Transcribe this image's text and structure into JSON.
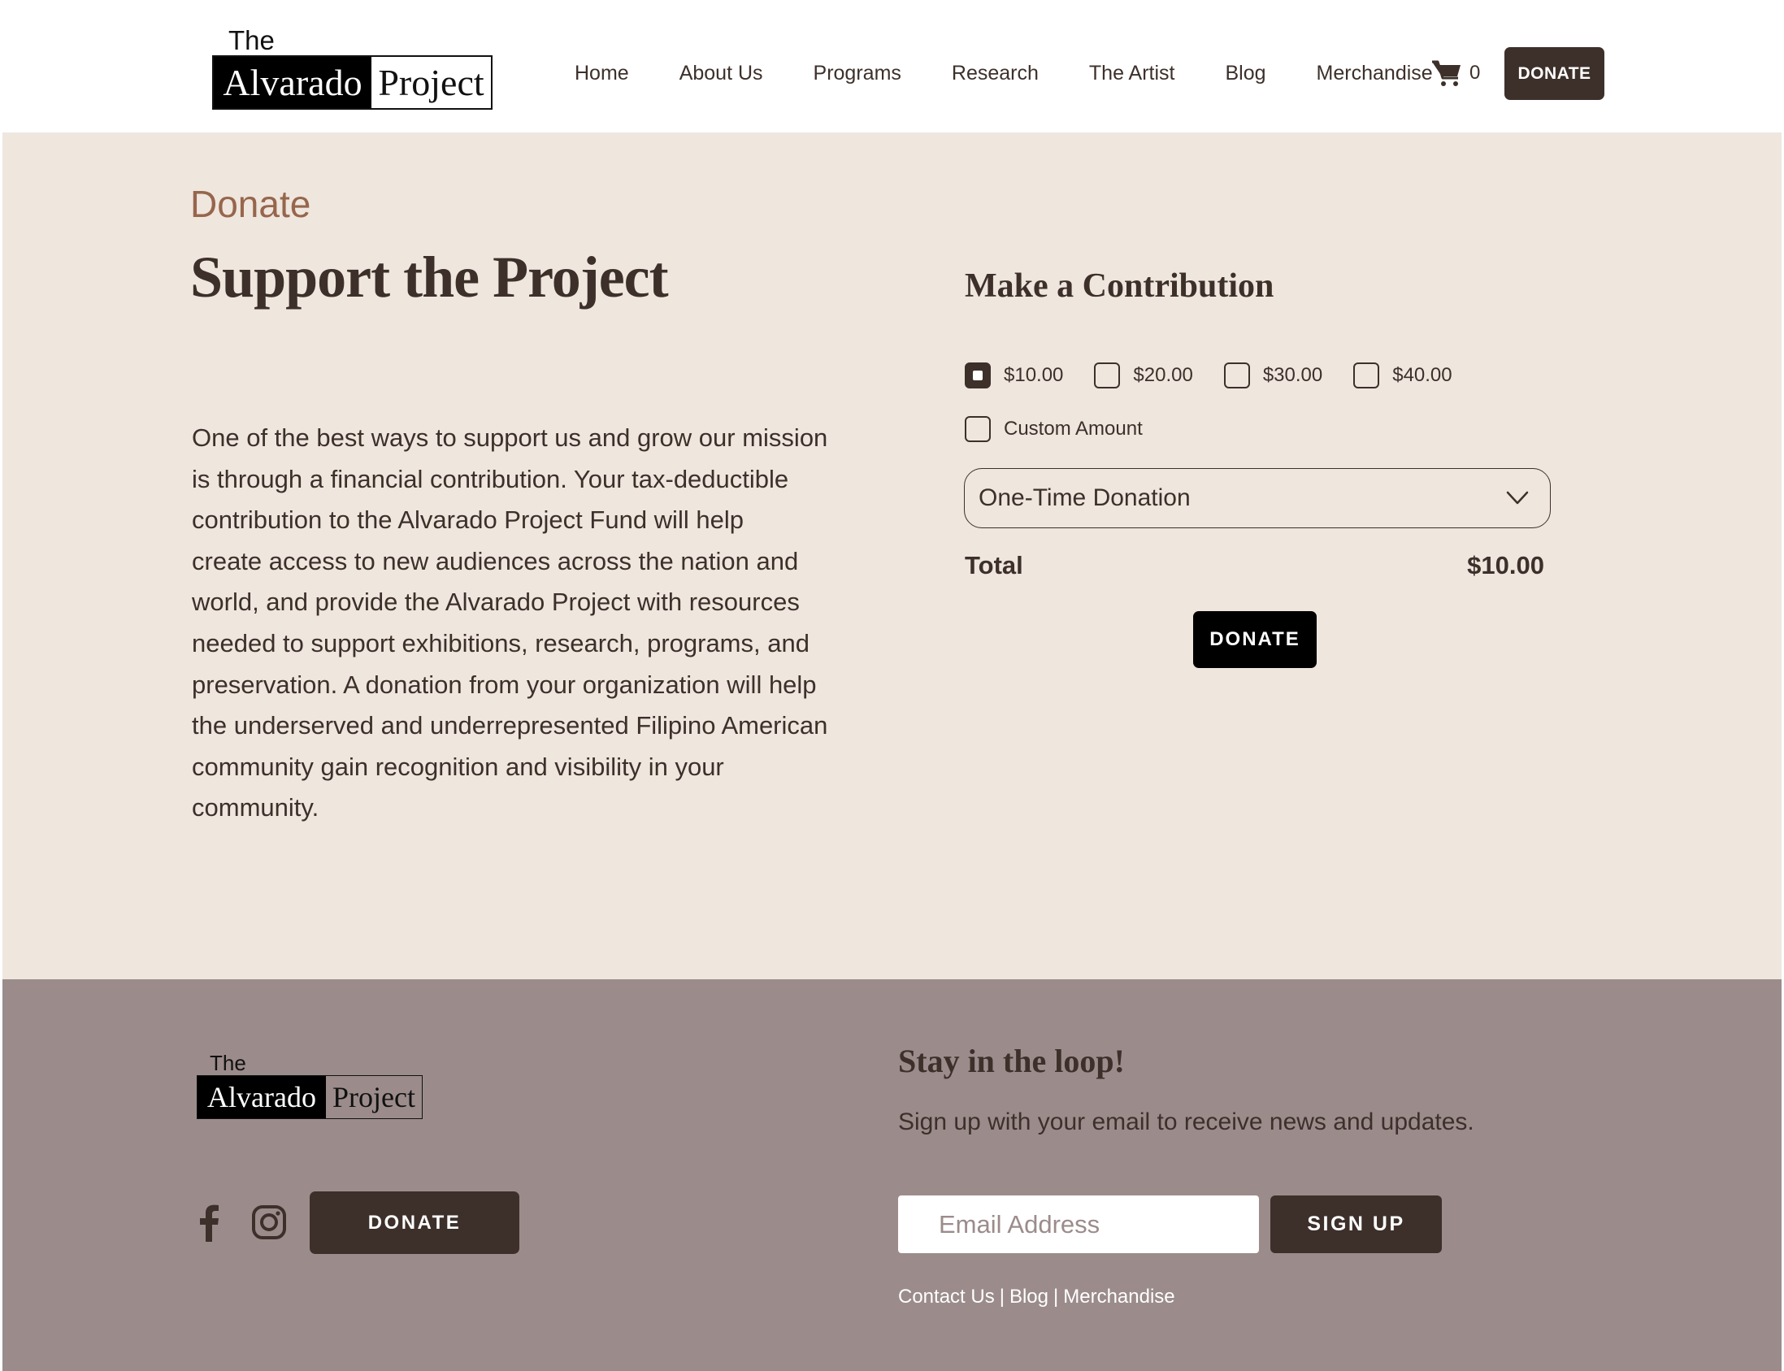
{
  "brand": {
    "logo_top": "The",
    "logo_left": "Alvarado",
    "logo_right": "Project"
  },
  "nav": {
    "items": [
      {
        "label": "Home"
      },
      {
        "label": "About Us"
      },
      {
        "label": "Programs"
      },
      {
        "label": "Research"
      },
      {
        "label": "The Artist"
      },
      {
        "label": "Blog"
      },
      {
        "label": "Merchandise"
      }
    ],
    "cart_icon": "cart-icon",
    "cart_count": "0",
    "donate_label": "DONATE"
  },
  "main": {
    "kicker": "Donate",
    "title": "Support the Project",
    "body_lines": [
      "One of the best ways to support us and grow our mission",
      "is through a financial contribution. Your tax-deductible",
      "contribution to the Alvarado Project Fund will help",
      "create access to new audiences across the nation and",
      "world, and provide the Alvarado Project with resources",
      "needed to support exhibitions, research, programs, and",
      "preservation. A donation from your organization will help",
      "the underserved and underrepresented Filipino American",
      "community gain recognition and visibility in your",
      "community."
    ]
  },
  "contribution": {
    "title": "Make a Contribution",
    "amounts": [
      {
        "label": "$10.00",
        "checked": true
      },
      {
        "label": "$20.00",
        "checked": false
      },
      {
        "label": "$30.00",
        "checked": false
      },
      {
        "label": "$40.00",
        "checked": false
      }
    ],
    "custom_label": "Custom Amount",
    "frequency": "One-Time Donation",
    "total_label": "Total",
    "total_value": "$10.00",
    "donate_label": "DONATE"
  },
  "footer": {
    "social": [
      "facebook-icon",
      "instagram-icon"
    ],
    "donate_label": "DONATE",
    "newsletter_title": "Stay in the loop!",
    "newsletter_sub": "Sign up with your email to receive news and updates.",
    "email_placeholder": "Email Address",
    "signup_label": "SIGN UP",
    "links": [
      "Contact Us",
      "Blog",
      "Merchandise"
    ],
    "separator": "|"
  },
  "colors": {
    "dark_brown": "#3d302b",
    "beige_bg": "#efe6de",
    "footer_bg": "#9b8c8b",
    "accent_kicker": "#96664c"
  }
}
